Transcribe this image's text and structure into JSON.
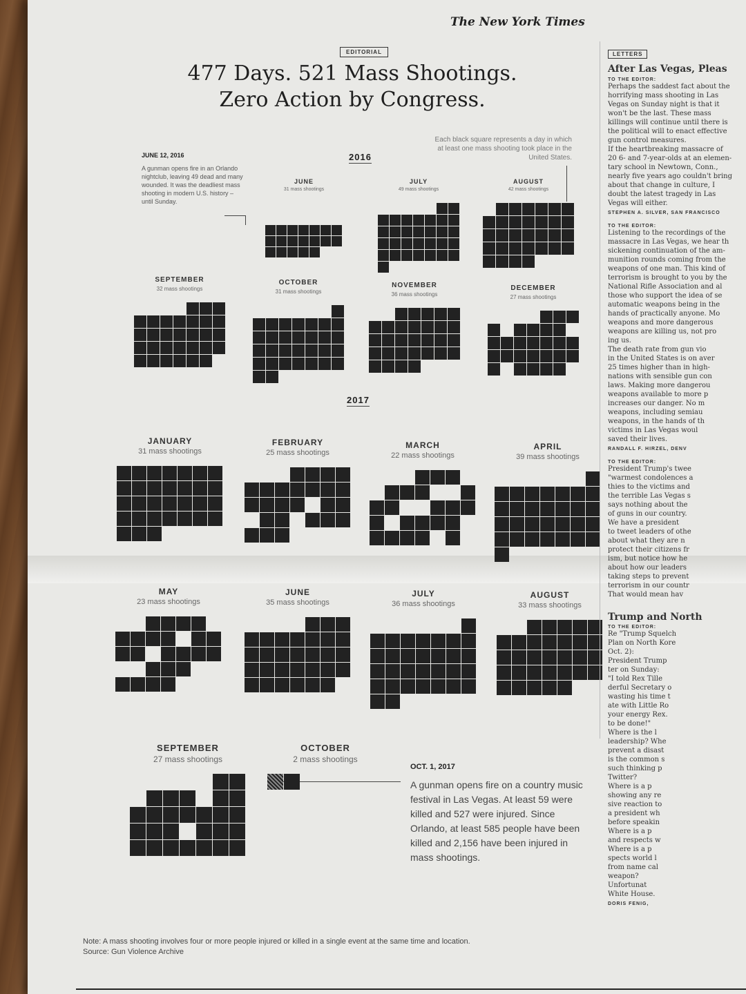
{
  "masthead": "The New York Times",
  "kicker": "EDITORIAL",
  "headline_line1": "477 Days. 521 Mass Shootings.",
  "headline_line2": "Zero Action by Congress.",
  "key_note": "Each black square represents a day in which at least one mass shooting took place in the United States.",
  "year_2016": "2016",
  "year_2017": "2017",
  "orlando_annotation": {
    "date": "JUNE 12, 2016",
    "text": "A gunman opens fire in an Orlando nightclub, leaving 49 dead and many wounded. It was the deadliest mass shooting in modern U.S. history – until Sunday."
  },
  "vegas_annotation": {
    "date": "OCT. 1, 2017",
    "text": "A gunman opens fire on a country music festival in Las Vegas. At least 59 were killed and 527 were injured. Since Orlando, at least 585 people have been killed and 2,156 have been injured in mass shootings."
  },
  "note": "Note: A mass shooting involves four or more people injured or killed in a single event at the same time and location.",
  "source": "Source: Gun Violence Archive",
  "chart_data": {
    "type": "calendar-grid",
    "title": "477 Days. 521 Mass Shootings. Zero Action by Congress.",
    "unit": "mass shootings",
    "months": [
      {
        "year": 2016,
        "month": "JUNE",
        "count": 31,
        "label": "31 mass shootings"
      },
      {
        "year": 2016,
        "month": "JULY",
        "count": 49,
        "label": "49 mass shootings"
      },
      {
        "year": 2016,
        "month": "AUGUST",
        "count": 42,
        "label": "42 mass shootings"
      },
      {
        "year": 2016,
        "month": "SEPTEMBER",
        "count": 32,
        "label": "32 mass shootings"
      },
      {
        "year": 2016,
        "month": "OCTOBER",
        "count": 31,
        "label": "31 mass shootings"
      },
      {
        "year": 2016,
        "month": "NOVEMBER",
        "count": 36,
        "label": "36 mass shootings"
      },
      {
        "year": 2016,
        "month": "DECEMBER",
        "count": 27,
        "label": "27 mass shootings"
      },
      {
        "year": 2017,
        "month": "JANUARY",
        "count": 31,
        "label": "31 mass shootings"
      },
      {
        "year": 2017,
        "month": "FEBRUARY",
        "count": 25,
        "label": "25 mass shootings"
      },
      {
        "year": 2017,
        "month": "MARCH",
        "count": 22,
        "label": "22 mass shootings"
      },
      {
        "year": 2017,
        "month": "APRIL",
        "count": 39,
        "label": "39 mass shootings"
      },
      {
        "year": 2017,
        "month": "MAY",
        "count": 23,
        "label": "23 mass shootings"
      },
      {
        "year": 2017,
        "month": "JUNE",
        "count": 35,
        "label": "35 mass shootings"
      },
      {
        "year": 2017,
        "month": "JULY",
        "count": 36,
        "label": "36 mass shootings"
      },
      {
        "year": 2017,
        "month": "AUGUST",
        "count": 33,
        "label": "33 mass shootings"
      },
      {
        "year": 2017,
        "month": "SEPTEMBER",
        "count": 27,
        "label": "27 mass shootings"
      },
      {
        "year": 2017,
        "month": "OCTOBER",
        "count": 2,
        "label": "2 mass shootings"
      }
    ]
  },
  "letters": {
    "kicker": "LETTERS",
    "headline1": "After Las Vegas, Pleas",
    "to_editor": "TO THE EDITOR:",
    "body1": [
      "Perhaps the saddest fact about the",
      "horrifying mass shooting in Las",
      "Vegas on Sunday night is that it",
      "won't be the last. These mass",
      "killings will continue until there is",
      "the political will to enact effective",
      "gun control measures.",
      "If the heartbreaking massacre of",
      "20 6- and 7-year-olds at an elemen-",
      "tary school in Newtown, Conn.,",
      "nearly five years ago couldn't bring",
      "about that change in culture, I",
      "doubt the latest tragedy in Las",
      "Vegas will either."
    ],
    "sig1": "STEPHEN A. SILVER, SAN FRANCISCO",
    "body2": [
      "Listening to the recordings of the",
      "massacre in Las Vegas, we hear th",
      "sickening continuation of the am-",
      "munition rounds coming from the",
      "weapons of one man. This kind of",
      "terrorism is brought to you by the",
      "National Rifle Association and al",
      "those who support the idea of se",
      "automatic weapons being in the",
      "hands of practically anyone. Mo",
      "weapons and more dangerous",
      "weapons are killing us, not pro",
      "ing us.",
      "The death rate from gun vio",
      "in the United States is on aver",
      "25 times higher than in high-",
      "nations with sensible gun con",
      "laws. Making more dangerou",
      "weapons available to more p",
      "increases our danger. No m",
      "weapons, including semiau",
      "weapons, in the hands of th",
      "victims in Las Vegas woul",
      "saved their lives."
    ],
    "sig2": "RANDALL F. HIRZEL, DENV",
    "body3": [
      "President Trump's twee",
      "\"warmest condolences a",
      "thies to the victims and",
      "the terrible Las Vegas s",
      "says nothing about the",
      "of guns in our country.",
      "We have a president",
      "to tweet leaders of othe",
      "about what they are n",
      "protect their citizens fr",
      "ism, but notice how he",
      "about how our leaders",
      "taking steps to prevent",
      "terrorism in our countr",
      "That would mean hav"
    ],
    "headline2": "Trump and North",
    "body4": [
      "Re \"Trump Squelch",
      "Plan on North Kore",
      "Oct. 2):",
      "President Trump",
      "ter on Sunday:",
      "\"I told Rex Tille",
      "derful Secretary o",
      "wasting his time t",
      "ate with Little Ro",
      "your energy Rex.",
      "to be done!\"",
      "Where is the l",
      "leadership? Whe",
      "prevent a disast",
      "is the common s",
      "such thinking p",
      "Twitter?",
      "Where is a p",
      "showing any re",
      "sive reaction to",
      "a president wh",
      "before speakin",
      "Where is a p",
      "and respects w",
      "Where is a p",
      "spects world l",
      "from name cal",
      "weapon?",
      "Unfortunat",
      "White House."
    ],
    "sig3": "DORIS FENIG,"
  }
}
